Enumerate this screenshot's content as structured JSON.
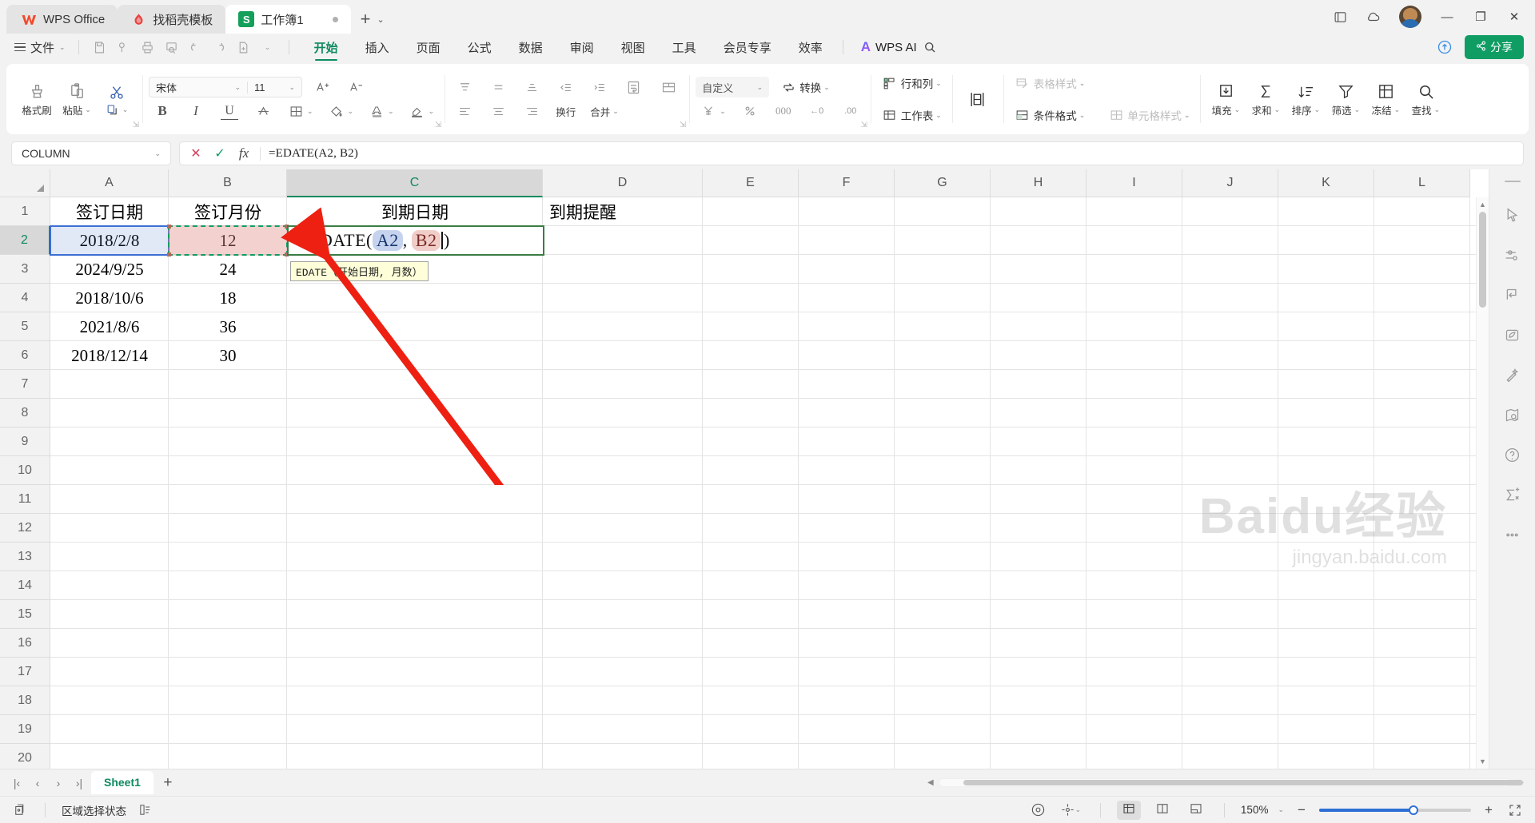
{
  "titlebar": {
    "tabs": [
      {
        "label": "WPS Office",
        "icon": "wps-logo-icon",
        "state": "inactive"
      },
      {
        "label": "找稻壳模板",
        "icon": "docer-logo-icon",
        "state": "inactive"
      },
      {
        "label": "工作簿1",
        "icon": "sheet-file-icon",
        "state": "active"
      }
    ],
    "new_tab": "+",
    "new_tab_caret": "⌄",
    "minimize": "—",
    "maximize": "▢",
    "close": "✕",
    "restore": "❐"
  },
  "menubar": {
    "file_label": "文件",
    "file_caret": "⌄",
    "quick_access": [
      "save-icon",
      "save-cloud-icon",
      "print-icon",
      "print-preview-icon",
      "undo-icon",
      "redo-icon",
      "new-doc-icon"
    ],
    "quick_caret": "⌄",
    "tabs": [
      {
        "label": "开始",
        "active": true
      },
      {
        "label": "插入",
        "active": false
      },
      {
        "label": "页面",
        "active": false
      },
      {
        "label": "公式",
        "active": false
      },
      {
        "label": "数据",
        "active": false
      },
      {
        "label": "审阅",
        "active": false
      },
      {
        "label": "视图",
        "active": false
      },
      {
        "label": "工具",
        "active": false
      },
      {
        "label": "会员专享",
        "active": false
      },
      {
        "label": "效率",
        "active": false
      }
    ],
    "ai_label": "WPS AI",
    "search_icon": "search-icon",
    "cloud_icon": "cloud-upload-icon",
    "share_label": "分享"
  },
  "ribbon": {
    "clipboard": {
      "format_painter": "格式刷",
      "paste": "粘贴",
      "copy": "复制",
      "cut_icon": "scissors-icon",
      "paste_icon": "clipboard-icon",
      "brush_icon": "format-painter-icon"
    },
    "font": {
      "name": "宋体",
      "size": "11",
      "grow_icon": "increase-font-icon",
      "shrink_icon": "decrease-font-icon",
      "bold": "B",
      "italic": "I",
      "underline": "U",
      "strike_icon": "strikethrough-icon",
      "border_icon": "borders-icon",
      "fill_icon": "fill-color-icon",
      "fontcolor_icon": "font-color-icon",
      "highlight_icon": "highlight-icon"
    },
    "align": {
      "wrap_text": "换行",
      "merge": "合并",
      "top_icon": "align-top-icon",
      "middle_icon": "align-middle-icon",
      "bottom_icon": "align-bottom-icon",
      "indent_dec_icon": "decrease-indent-icon",
      "indent_inc_icon": "increase-indent-icon",
      "left_icon": "align-left-icon",
      "center_icon": "align-center-icon",
      "right_icon": "align-right-icon"
    },
    "number": {
      "format": "自定义",
      "convert": "转换",
      "currency_icon": "currency-icon",
      "percent_icon": "percent-icon",
      "comma_icon": "comma-style-icon",
      "inc_dec_icon": "increase-decimal-icon",
      "dec_dec_icon": "decrease-decimal-icon"
    },
    "cells": {
      "rows_cols": "行和列",
      "worksheet": "工作表",
      "cell_style_merge_icon": "merge-cells-icon",
      "table_style": "表格样式",
      "cond_format": "条件格式",
      "cell_styles": "单元格样式"
    },
    "editing": {
      "fill": "填充",
      "sum": "求和",
      "sort": "排序",
      "filter": "筛选",
      "freeze": "冻结",
      "find": "查找"
    }
  },
  "formulabar": {
    "namebox": "COLUMN",
    "namebox_caret": "⌄",
    "cancel_icon": "cancel-icon",
    "confirm_icon": "confirm-icon",
    "fx_icon": "fx-icon",
    "formula": "=EDATE(A2, B2)"
  },
  "sheet": {
    "columns": [
      "A",
      "B",
      "C",
      "D",
      "E",
      "F",
      "G",
      "H",
      "I",
      "J",
      "K",
      "L"
    ],
    "selected_column": "C",
    "rows": [
      "1",
      "2",
      "3",
      "4",
      "5",
      "6",
      "7",
      "8",
      "9",
      "10",
      "11",
      "12",
      "13",
      "14",
      "15",
      "16",
      "17",
      "18",
      "19",
      "20"
    ],
    "selected_row": "2",
    "data": [
      {
        "A": "签订日期",
        "B": "签订月份",
        "C": "到期日期",
        "D": "到期提醒"
      },
      {
        "A": "2018/2/8",
        "B": "12",
        "C": "",
        "D": ""
      },
      {
        "A": "2024/9/25",
        "B": "24",
        "C": "",
        "D": ""
      },
      {
        "A": "2018/10/6",
        "B": "18",
        "C": "",
        "D": ""
      },
      {
        "A": "2021/8/6",
        "B": "36",
        "C": "",
        "D": ""
      },
      {
        "A": "2018/12/14",
        "B": "30",
        "C": "",
        "D": ""
      }
    ],
    "editing_cell": {
      "address": "C2",
      "prefix": "=EDATE(",
      "arg1": "A2",
      "separator": ",",
      "arg2": "B2",
      "suffix": ")"
    },
    "tooltip": "EDATE（开始日期, 月数）",
    "watermark_main": "Baidu经验",
    "watermark_sub": "jingyan.baidu.com"
  },
  "right_dock": {
    "items": [
      {
        "icon": "cursor-select-icon"
      },
      {
        "icon": "settings-sliders-icon"
      },
      {
        "icon": "text-wrap-icon"
      },
      {
        "icon": "picture-leaf-icon"
      },
      {
        "icon": "magic-wand-icon"
      },
      {
        "icon": "map-search-icon"
      },
      {
        "icon": "help-circle-icon"
      },
      {
        "icon": "formula-sum-icon"
      },
      {
        "icon": "more-dots-icon"
      }
    ]
  },
  "sheetbar": {
    "first": "|‹",
    "prev": "‹",
    "next": "›",
    "last": "›|",
    "tabs": [
      {
        "label": "Sheet1",
        "active": true
      }
    ],
    "add": "+"
  },
  "statusbar": {
    "record_icon": "macro-record-icon",
    "mode_text": "区域选择状态",
    "list_icon": "selection-list-icon",
    "eye_icon": "view-eye-icon",
    "move_icon": "move-tool-icon",
    "view_normal_icon": "normal-view-icon",
    "view_page_icon": "page-layout-icon",
    "view_break_icon": "page-break-icon",
    "zoom": "150%",
    "zoom_caret": "⌄",
    "zoom_out": "−",
    "zoom_in": "+",
    "fullscreen_icon": "fullscreen-icon"
  },
  "colors": {
    "accent_green": "#0f8a5f",
    "share_green": "#0f9d63",
    "selection_blue": "#3b6fd4",
    "ref_b_pink": "#e08682",
    "arrow_red": "#ee2012",
    "zoom_blue": "#2d6fd4"
  }
}
